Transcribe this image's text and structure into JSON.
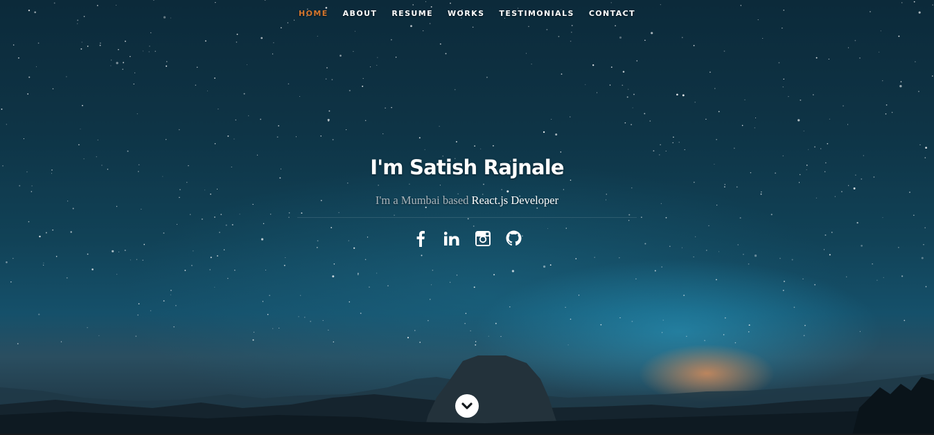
{
  "nav": {
    "items": [
      {
        "label": "Home",
        "current": true
      },
      {
        "label": "About",
        "current": false
      },
      {
        "label": "Resume",
        "current": false
      },
      {
        "label": "Works",
        "current": false
      },
      {
        "label": "Testimonials",
        "current": false
      },
      {
        "label": "Contact",
        "current": false
      }
    ]
  },
  "banner": {
    "headline": "I'm Satish Rajnale",
    "subtitle_prefix": "I'm a Mumbai based",
    "subtitle_highlight": "React.js Developer"
  },
  "social": [
    {
      "name": "facebook",
      "icon": "facebook-icon"
    },
    {
      "name": "linkedin",
      "icon": "linkedin-icon"
    },
    {
      "name": "instagram",
      "icon": "instagram-icon"
    },
    {
      "name": "github",
      "icon": "github-icon"
    }
  ],
  "scroll_down": {
    "icon": "chevron-down-icon"
  },
  "colors": {
    "accent": "#d4762d",
    "text": "#ffffff",
    "subtitle": "#a9b4bb"
  }
}
